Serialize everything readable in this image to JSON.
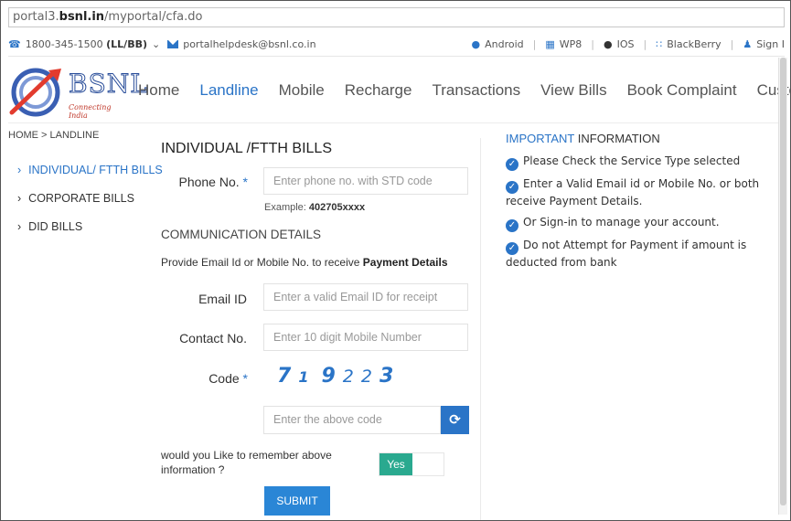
{
  "browser": {
    "url_prefix": "portal3.",
    "url_domain": "bsnl.in",
    "url_path": "/myportal/cfa.do"
  },
  "topbar": {
    "phone_number": "1800-345-1500",
    "phone_suffix": "(LL/BB)",
    "email": "portalhelpdesk@bsnl.co.in",
    "links": [
      "Android",
      "WP8",
      "IOS",
      "BlackBerry",
      "Sign I"
    ]
  },
  "header": {
    "logo_text": "BSNL",
    "logo_tagline": "Connecting India",
    "nav": [
      "Home",
      "Landline",
      "Mobile",
      "Recharge",
      "Transactions",
      "View Bills",
      "Book Complaint",
      "Customer Ca"
    ],
    "active_nav": "Landline"
  },
  "breadcrumb": "HOME  >  LANDLINE",
  "sidebar": {
    "items": [
      "INDIVIDUAL/ FTTH BILLS",
      "CORPORATE BILLS",
      "DID BILLS"
    ]
  },
  "form": {
    "title": "INDIVIDUAL /FTTH BILLS",
    "phone_label": "Phone No.",
    "phone_placeholder": "Enter phone no. with STD code",
    "example_label": "Example:",
    "example_value": "402705xxxx",
    "comm_title": "COMMUNICATION DETAILS",
    "provide_text": "Provide Email Id or Mobile No. to receive",
    "provide_bold": "Payment Details",
    "email_label": "Email ID",
    "email_placeholder": "Enter a valid Email ID for receipt",
    "contact_label": "Contact No.",
    "contact_placeholder": "Enter 10 digit Mobile Number",
    "code_label": "Code",
    "captcha": [
      "7",
      "1",
      "9",
      "2",
      "2",
      "3"
    ],
    "code_placeholder": "Enter the above code",
    "remember_text": "would you Like to remember above information ?",
    "toggle_label": "Yes",
    "submit_label": "SUBMIT",
    "required_marker": "*"
  },
  "info": {
    "title_a": "IMPORTANT",
    "title_b": "INFORMATION",
    "items": [
      "Please Check the Service Type selected",
      "Enter a Valid Email id or Mobile No. or both receive Payment Details.",
      "Or Sign-in to manage your account.",
      "Do not Attempt for Payment if amount is deducted from bank"
    ]
  },
  "colors": {
    "accent": "#2a74c7",
    "toggle_on": "#2aa98f",
    "submit": "#2a86d6"
  }
}
